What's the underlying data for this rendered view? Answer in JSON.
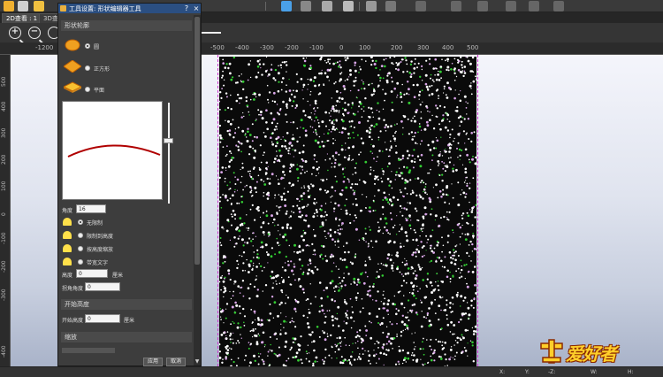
{
  "tabs": [
    {
      "label": "2D查看 : 1",
      "active": true
    },
    {
      "label": "3D查看",
      "active": false
    }
  ],
  "ruler": {
    "h_labels": [
      "-1200",
      "-500",
      "-400",
      "-300",
      "-200",
      "-100",
      "0",
      "100",
      "200",
      "300",
      "400",
      "500"
    ],
    "v_labels": [
      "500",
      "400",
      "300",
      "200",
      "100",
      "0",
      "-100",
      "-200",
      "-300",
      "-400"
    ]
  },
  "dialog": {
    "title": "工具设置: 形状编辑器工具",
    "help": "?",
    "close": "×",
    "section_shape": "形状轮廓",
    "shape_options": [
      {
        "label": "圆",
        "checked": true
      },
      {
        "label": "正方形",
        "checked": false
      },
      {
        "label": "平面",
        "checked": false
      }
    ],
    "angle_label": "角度",
    "angle_value": "16",
    "limit_options": [
      {
        "label": "无限制",
        "checked": true
      },
      {
        "label": "限制到高度",
        "checked": false
      },
      {
        "label": "按高度缩放",
        "checked": false
      },
      {
        "label": "带宽文字",
        "checked": false
      }
    ],
    "height_label": "高度",
    "height_value": "0",
    "height_unit": "厘米",
    "corner_label": "拐角角度",
    "corner_value": "0",
    "section_start": "开始高度",
    "start_height_label": "开始高度",
    "start_height_value": "0",
    "start_height_unit": "厘米",
    "section_scale": "缩放",
    "apply": "应用",
    "cancel": "取消"
  },
  "status": {
    "x": "X:",
    "y": "Y:",
    "y_value": "-Z:",
    "w": "W:",
    "h": "H:"
  },
  "logo": {
    "text": "爱好者"
  },
  "colors": {
    "accent": "#2b4f82",
    "guide": "#cc33cc",
    "curve": "#b00000",
    "dots_white": "#ffffff",
    "dots_pink": "#d9a6e8",
    "dots_green": "#33cc33"
  }
}
